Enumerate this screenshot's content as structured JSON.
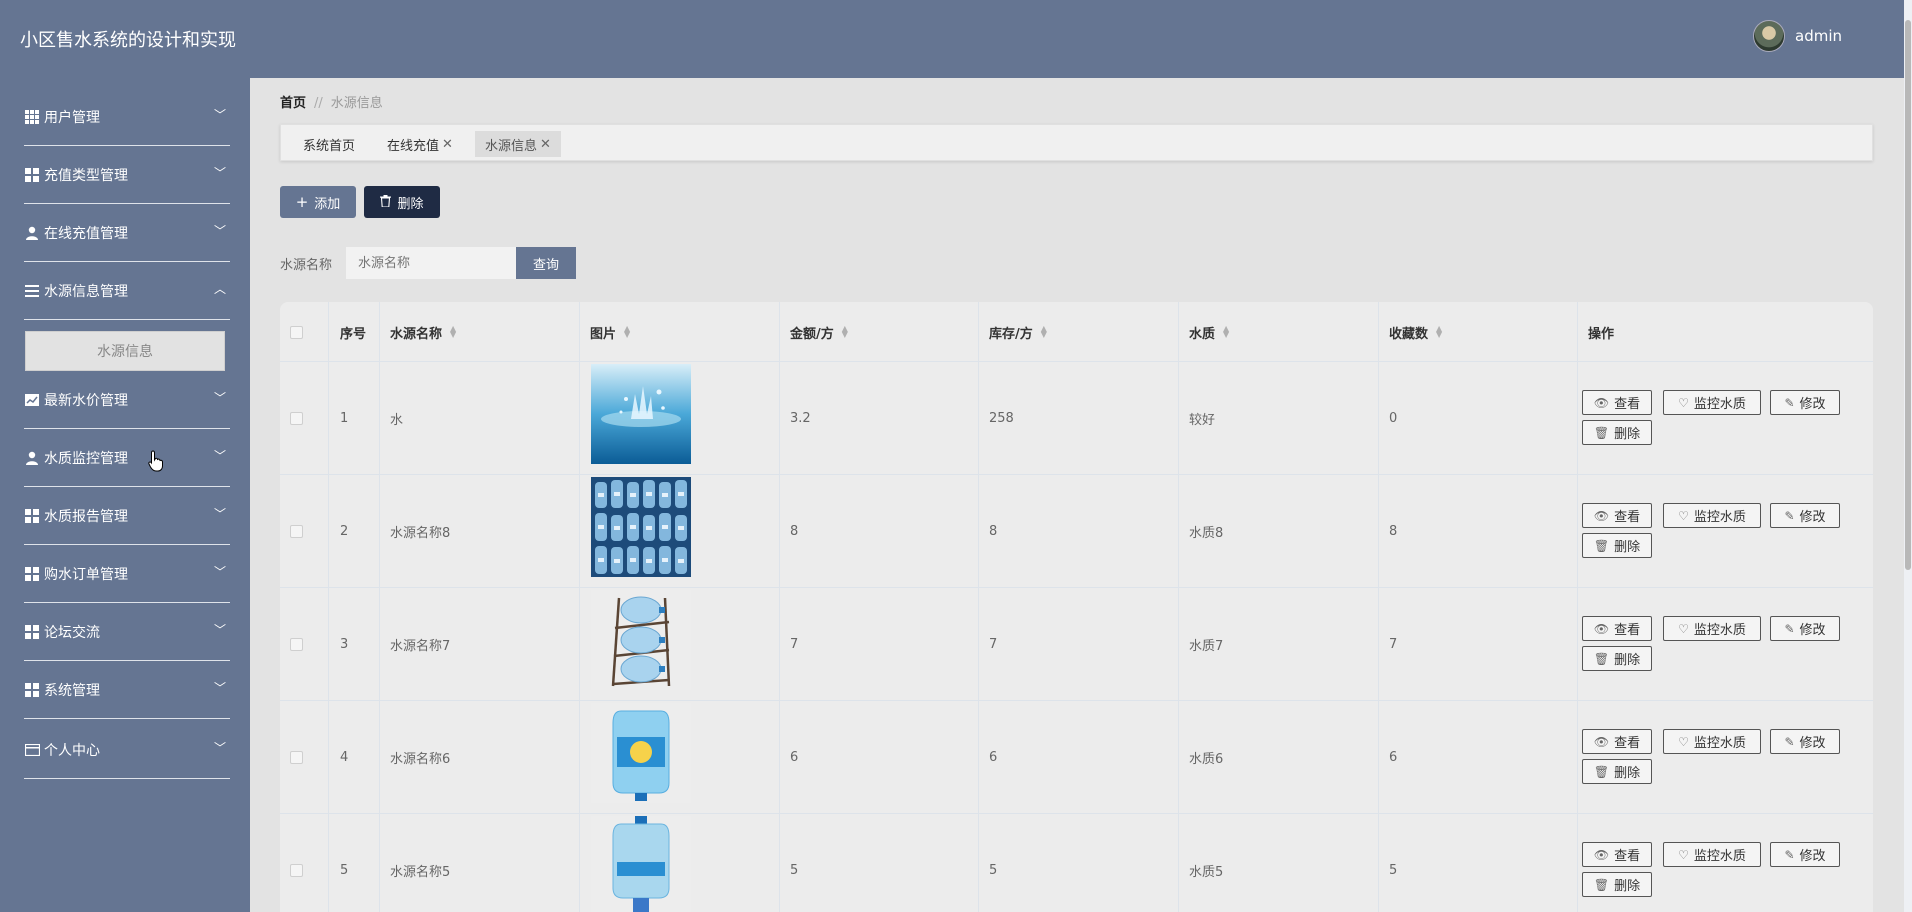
{
  "app": {
    "title": "小区售水系统的设计和实现",
    "user_name": "admin"
  },
  "sidebar": {
    "items": [
      {
        "label": "用户管理",
        "icon": "table-icon"
      },
      {
        "label": "充值类型管理",
        "icon": "grid-icon"
      },
      {
        "label": "在线充值管理",
        "icon": "user-icon"
      },
      {
        "label": "水源信息管理",
        "icon": "list-icon",
        "expanded": true
      },
      {
        "label": "最新水价管理",
        "icon": "chart-icon"
      },
      {
        "label": "水质监控管理",
        "icon": "user-icon"
      },
      {
        "label": "水质报告管理",
        "icon": "grid-icon"
      },
      {
        "label": "购水订单管理",
        "icon": "grid-icon"
      },
      {
        "label": "论坛交流",
        "icon": "grid-icon"
      },
      {
        "label": "系统管理",
        "icon": "grid-icon"
      },
      {
        "label": "个人中心",
        "icon": "card-icon"
      }
    ],
    "submenu_active": "水源信息"
  },
  "breadcrumb": {
    "home": "首页",
    "separator": "//",
    "current": "水源信息"
  },
  "tabs": [
    {
      "label": "系统首页",
      "closable": false
    },
    {
      "label": "在线充值",
      "closable": true
    },
    {
      "label": "水源信息",
      "closable": true,
      "active": true
    }
  ],
  "toolbar": {
    "add_label": "添加",
    "delete_label": "删除"
  },
  "search": {
    "label": "水源名称",
    "placeholder": "水源名称",
    "button": "查询"
  },
  "table": {
    "columns": [
      "序号",
      "水源名称",
      "图片",
      "金额/方",
      "库存/方",
      "水质",
      "收藏数",
      "操作"
    ],
    "rows": [
      {
        "index": "1",
        "name": "水",
        "image": "water-splash-image",
        "price": "3.2",
        "stock": "258",
        "quality": "较好",
        "favorites": "0"
      },
      {
        "index": "2",
        "name": "水源名称8",
        "image": "bottled-water-pack-image",
        "price": "8",
        "stock": "8",
        "quality": "水质8",
        "favorites": "8"
      },
      {
        "index": "3",
        "name": "水源名称7",
        "image": "water-bucket-rack-image",
        "price": "7",
        "stock": "7",
        "quality": "水质7",
        "favorites": "7"
      },
      {
        "index": "4",
        "name": "水源名称6",
        "image": "water-bucket-image",
        "price": "6",
        "stock": "6",
        "quality": "水质6",
        "favorites": "6"
      },
      {
        "index": "5",
        "name": "水源名称5",
        "image": "water-bucket-dispenser-image",
        "price": "5",
        "stock": "5",
        "quality": "水质5",
        "favorites": "5"
      }
    ],
    "actions": {
      "view": "查看",
      "monitor": "监控水质",
      "edit": "修改",
      "delete": "删除"
    }
  },
  "colors": {
    "primary": "#657592",
    "dark": "#1f2b44",
    "background": "#e3e3e3"
  }
}
